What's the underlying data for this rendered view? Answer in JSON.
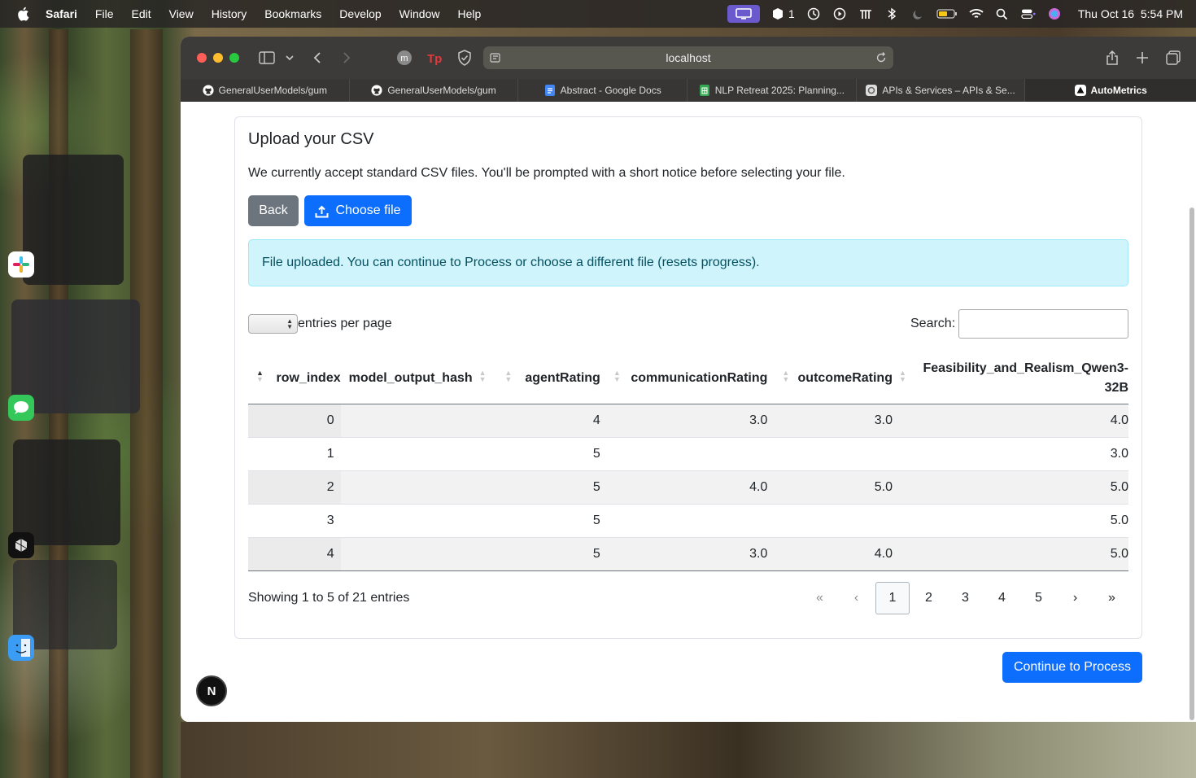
{
  "menubar": {
    "app": "Safari",
    "items": [
      "File",
      "Edit",
      "View",
      "History",
      "Bookmarks",
      "Develop",
      "Window",
      "Help"
    ],
    "clock": "Thu Oct 16  5:54 PM",
    "badge_count": "1"
  },
  "browser": {
    "address": "localhost",
    "tabs": [
      {
        "label": "GeneralUserModels/gum",
        "icon": "github-icon"
      },
      {
        "label": "GeneralUserModels/gum",
        "icon": "github-icon"
      },
      {
        "label": "Abstract - Google Docs",
        "icon": "google-docs-icon"
      },
      {
        "label": "NLP Retreat 2025: Planning...",
        "icon": "google-sheets-icon"
      },
      {
        "label": "APIs & Services – APIs & Se...",
        "icon": "google-cloud-icon"
      },
      {
        "label": "AutoMetrics",
        "icon": "autometrics-icon"
      }
    ]
  },
  "upload": {
    "title": "Upload your CSV",
    "description": "We currently accept standard CSV files. You'll be prompted with a short notice before selecting your file.",
    "back_label": "Back",
    "choose_label": "Choose file",
    "alert": "File uploaded. You can continue to Process or choose a different file (resets progress)."
  },
  "datatable": {
    "entries_label": "entries per page",
    "search_label": "Search:",
    "columns": [
      "row_index",
      "model_output_hash",
      "agentRating",
      "communicationRating",
      "outcomeRating",
      "Feasibility_and_Realism_Qwen3-32B"
    ],
    "rows": [
      [
        "0",
        "",
        "4",
        "3.0",
        "3.0",
        "4.0"
      ],
      [
        "1",
        "",
        "5",
        "",
        "",
        "3.0"
      ],
      [
        "2",
        "",
        "5",
        "4.0",
        "5.0",
        "5.0"
      ],
      [
        "3",
        "",
        "5",
        "",
        "",
        "5.0"
      ],
      [
        "4",
        "",
        "5",
        "3.0",
        "4.0",
        "5.0"
      ]
    ],
    "info": "Showing 1 to 5 of 21 entries",
    "pager": {
      "first": "«",
      "prev": "‹",
      "pages": [
        "1",
        "2",
        "3",
        "4",
        "5"
      ],
      "current": "1",
      "next": "›",
      "last": "»"
    }
  },
  "continue_label": "Continue to Process",
  "badge_letter": "N",
  "colors": {
    "primary": "#0d6efd",
    "secondary": "#6c757d",
    "alert_bg": "#cff4fc",
    "alert_text": "#055160"
  }
}
